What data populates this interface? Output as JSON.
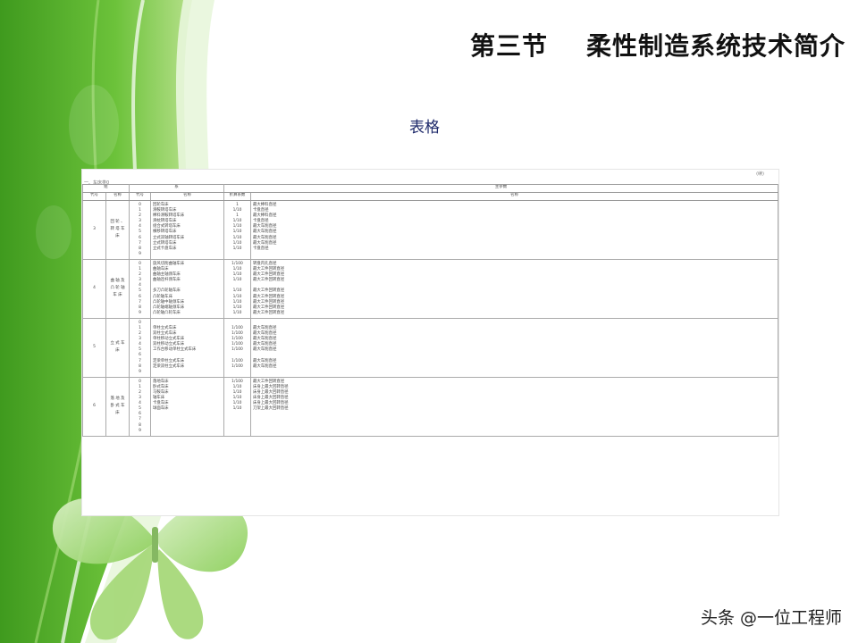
{
  "title": "第三节    柔性制造系统技术简介",
  "subtitle": "表格",
  "watermark": "头条 @一位工程师",
  "table": {
    "unit_note": "(续)",
    "caption": "一、车床类0",
    "headers": {
      "group": "组",
      "series": "系",
      "param": "主参数",
      "code": "代号",
      "name": "名称",
      "factor": "折算系数",
      "pname": "名称"
    },
    "groups": [
      {
        "code": "3",
        "name": "回 轮 、 转 塔 车 床",
        "series": [
          {
            "code": "0",
            "name": "回轮车床",
            "factor": "1",
            "param": "最大棒料直径"
          },
          {
            "code": "1",
            "name": "滑鞍转塔车床",
            "factor": "1/10",
            "param": "卡盘直径"
          },
          {
            "code": "2",
            "name": "棒料滑鞍转塔车床",
            "factor": "1",
            "param": "最大棒料直径"
          },
          {
            "code": "3",
            "name": "滑枕转塔车床",
            "factor": "1/10",
            "param": "卡盘直径"
          },
          {
            "code": "4",
            "name": "组合式转塔车床",
            "factor": "1/10",
            "param": "最大车削直径"
          },
          {
            "code": "5",
            "name": "横移转塔车床",
            "factor": "1/10",
            "param": "最大车削直径"
          },
          {
            "code": "6",
            "name": "立式双轴转塔车床",
            "factor": "1/10",
            "param": "最大车削直径"
          },
          {
            "code": "7",
            "name": "立式转塔车床",
            "factor": "1/10",
            "param": "最大车削直径"
          },
          {
            "code": "8",
            "name": "立式卡盘车床",
            "factor": "1/10",
            "param": "卡盘直径"
          },
          {
            "code": "9",
            "name": "",
            "factor": "",
            "param": ""
          }
        ]
      },
      {
        "code": "4",
        "name": "曲 轴 及 凸 轮 轴 车 床",
        "series": [
          {
            "code": "0",
            "name": "旋风切削曲轴车床",
            "factor": "1/100",
            "param": "转盘内孔直径"
          },
          {
            "code": "1",
            "name": "曲轴车床",
            "factor": "1/10",
            "param": "最大工件回转直径"
          },
          {
            "code": "2",
            "name": "曲轴主轴颈车床",
            "factor": "1/10",
            "param": "最大工件回转直径"
          },
          {
            "code": "3",
            "name": "曲轴连杆颈车床",
            "factor": "1/10",
            "param": "最大工件回转直径"
          },
          {
            "code": "4",
            "name": "",
            "factor": "",
            "param": ""
          },
          {
            "code": "5",
            "name": "多刀凸轮轴车床",
            "factor": "1/10",
            "param": "最大工件回转直径"
          },
          {
            "code": "6",
            "name": "凸轮轴车床",
            "factor": "1/10",
            "param": "最大工件回转直径"
          },
          {
            "code": "7",
            "name": "凸轮轴中轴颈车床",
            "factor": "1/10",
            "param": "最大工件回转直径"
          },
          {
            "code": "8",
            "name": "凸轮轴端轴颈车床",
            "factor": "1/10",
            "param": "最大工件回转直径"
          },
          {
            "code": "9",
            "name": "凸轮轴凸轮车床",
            "factor": "1/10",
            "param": "最大工件回转直径"
          }
        ]
      },
      {
        "code": "5",
        "name": "立 式 车 床",
        "series": [
          {
            "code": "0",
            "name": "",
            "factor": "",
            "param": ""
          },
          {
            "code": "1",
            "name": "单柱立式车床",
            "factor": "1/100",
            "param": "最大车削直径"
          },
          {
            "code": "2",
            "name": "双柱立式车床",
            "factor": "1/100",
            "param": "最大车削直径"
          },
          {
            "code": "3",
            "name": "单柱移动立式车床",
            "factor": "1/100",
            "param": "最大车削直径"
          },
          {
            "code": "4",
            "name": "双柱移动立式车床",
            "factor": "1/100",
            "param": "最大车削直径"
          },
          {
            "code": "5",
            "name": "工作台移动单柱立式车床",
            "factor": "1/100",
            "param": "最大车削直径"
          },
          {
            "code": "6",
            "name": "",
            "factor": "",
            "param": ""
          },
          {
            "code": "7",
            "name": "定梁单柱立式车床",
            "factor": "1/100",
            "param": "最大车削直径"
          },
          {
            "code": "8",
            "name": "定梁双柱立式车床",
            "factor": "1/100",
            "param": "最大车削直径"
          },
          {
            "code": "9",
            "name": "",
            "factor": "",
            "param": ""
          }
        ]
      },
      {
        "code": "6",
        "name": "落 地 及 卧 式 车 床",
        "series": [
          {
            "code": "0",
            "name": "落地车床",
            "factor": "1/100",
            "param": "最大工件回转直径"
          },
          {
            "code": "1",
            "name": "卧式车床",
            "factor": "1/10",
            "param": "床身上最大回转直径"
          },
          {
            "code": "2",
            "name": "马鞍车床",
            "factor": "1/10",
            "param": "床身上最大回转直径"
          },
          {
            "code": "3",
            "name": "轴车床",
            "factor": "1/10",
            "param": "床身上最大回转直径"
          },
          {
            "code": "4",
            "name": "卡盘车床",
            "factor": "1/10",
            "param": "床身上最大回转直径"
          },
          {
            "code": "5",
            "name": "球面车床",
            "factor": "1/10",
            "param": "刀架上最大回转直径"
          },
          {
            "code": "6",
            "name": "",
            "factor": "",
            "param": ""
          },
          {
            "code": "7",
            "name": "",
            "factor": "",
            "param": ""
          },
          {
            "code": "8",
            "name": "",
            "factor": "",
            "param": ""
          },
          {
            "code": "9",
            "name": "",
            "factor": "",
            "param": ""
          }
        ]
      }
    ]
  }
}
